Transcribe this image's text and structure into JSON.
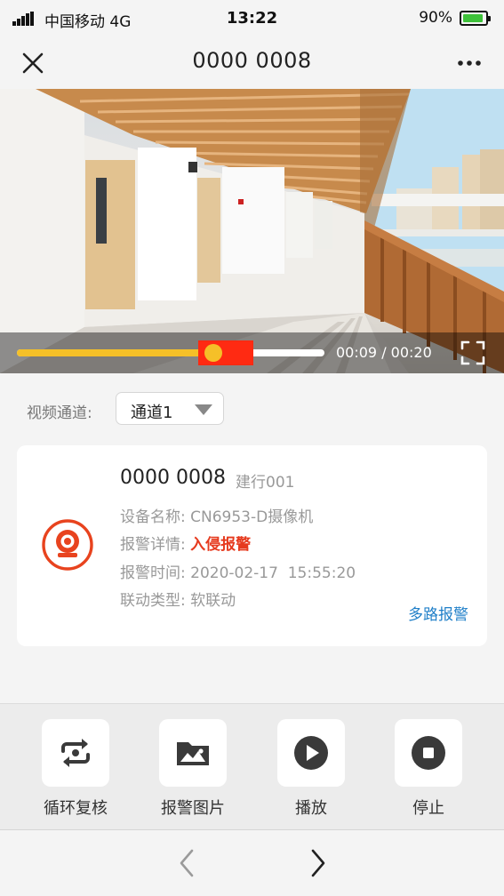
{
  "status_bar": {
    "carrier": "中国移动 4G",
    "time": "13:22",
    "battery": "90%",
    "battery_level": 0.9,
    "battery_color": "#3ec13a"
  },
  "nav": {
    "title": "0000 0008",
    "close_icon": "close-icon",
    "more_icon": "more-dots-icon"
  },
  "player": {
    "progress": 0.64,
    "alarm_segment_start": 0.59,
    "alarm_segment_end": 0.77,
    "time_text": "00:09 / 00:20",
    "progress_color": "#f5c028",
    "alarm_color": "#ff2a12",
    "fullscreen_icon": "fullscreen-icon"
  },
  "channel": {
    "label": "视频通道:",
    "value": "通道1"
  },
  "card": {
    "title": "0000 0008",
    "subtitle": "建行001",
    "icon": "camera-icon",
    "rows": [
      {
        "key": "设备名称:",
        "value": "CN6953-D摄像机"
      },
      {
        "key": "报警详情:",
        "value": "入侵报警"
      },
      {
        "key": "报警时间:",
        "value": "2020-02-17  15:55:20"
      },
      {
        "key": "联动类型:",
        "value": "软联动"
      }
    ],
    "alert_color": "#e63a1e",
    "link": "多路报警",
    "link_color": "#1f7fc8"
  },
  "actions": [
    {
      "label": "循环复核",
      "icon": "loop-review-icon"
    },
    {
      "label": "报警图片",
      "icon": "image-folder-icon"
    },
    {
      "label": "播放",
      "icon": "play-icon"
    },
    {
      "label": "停止",
      "icon": "stop-icon"
    }
  ],
  "bottom_nav": {
    "prev_icon": "chevron-left-icon",
    "next_icon": "chevron-right-icon"
  }
}
